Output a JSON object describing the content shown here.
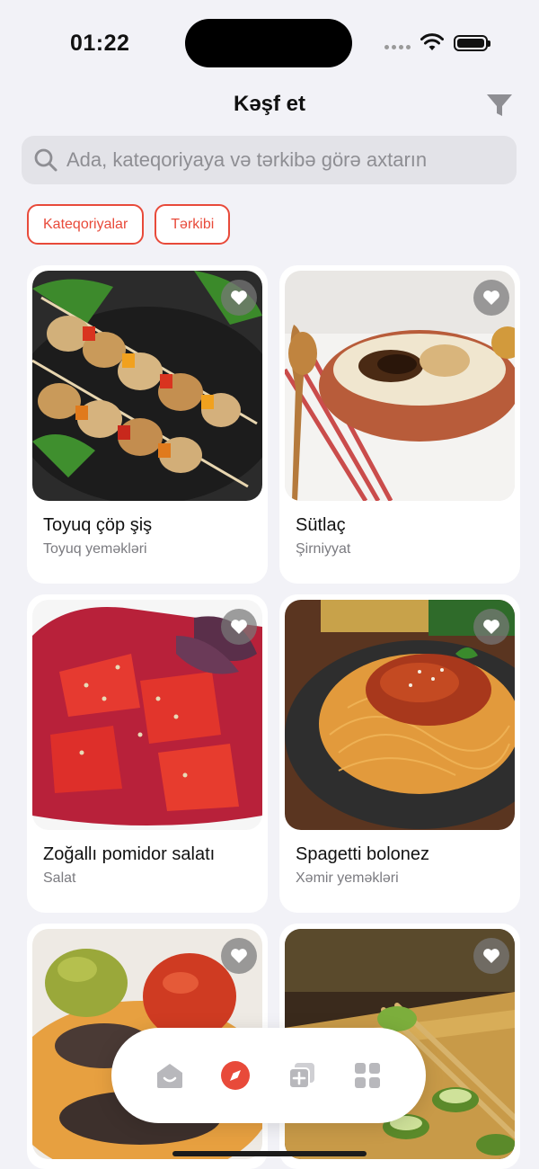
{
  "status_bar": {
    "time": "01:22",
    "icons": [
      "cellular-signal-icon",
      "wifi-icon",
      "battery-icon"
    ],
    "battery_level": 1.0
  },
  "header": {
    "title": "Kəşf et",
    "filter_icon": "filter-funnel-icon"
  },
  "search": {
    "placeholder": "Ada, kateqoriyaya və tərkibə görə axtarın",
    "icon": "search-icon"
  },
  "chips": [
    {
      "label": "Kateqoriyalar"
    },
    {
      "label": "Tərkibi"
    }
  ],
  "recipes": [
    {
      "title": "Toyuq çöp şiş",
      "category": "Toyuq yeməkləri",
      "favorite_icon": "heart-icon"
    },
    {
      "title": "Sütlaç",
      "category": "Şirniyyat",
      "favorite_icon": "heart-icon"
    },
    {
      "title": "Zoğallı pomidor salatı",
      "category": "Salat",
      "favorite_icon": "heart-icon"
    },
    {
      "title": "Spagetti bolonez",
      "category": "Xəmir yeməkləri",
      "favorite_icon": "heart-icon"
    },
    {
      "title": "",
      "category": "",
      "favorite_icon": "heart-icon"
    },
    {
      "title": "",
      "category": "",
      "favorite_icon": "heart-icon"
    }
  ],
  "bottom_nav": {
    "items": [
      {
        "icon": "home-icon",
        "active": false
      },
      {
        "icon": "compass-icon",
        "active": true
      },
      {
        "icon": "add-collection-icon",
        "active": false
      },
      {
        "icon": "grid-icon",
        "active": false
      }
    ]
  },
  "colors": {
    "accent": "#e84a3a",
    "background": "#f2f2f7",
    "card": "#ffffff",
    "search_bg": "#e3e3e8",
    "secondary_text": "#7b7b80",
    "inactive_icon": "#b8b8bc"
  }
}
